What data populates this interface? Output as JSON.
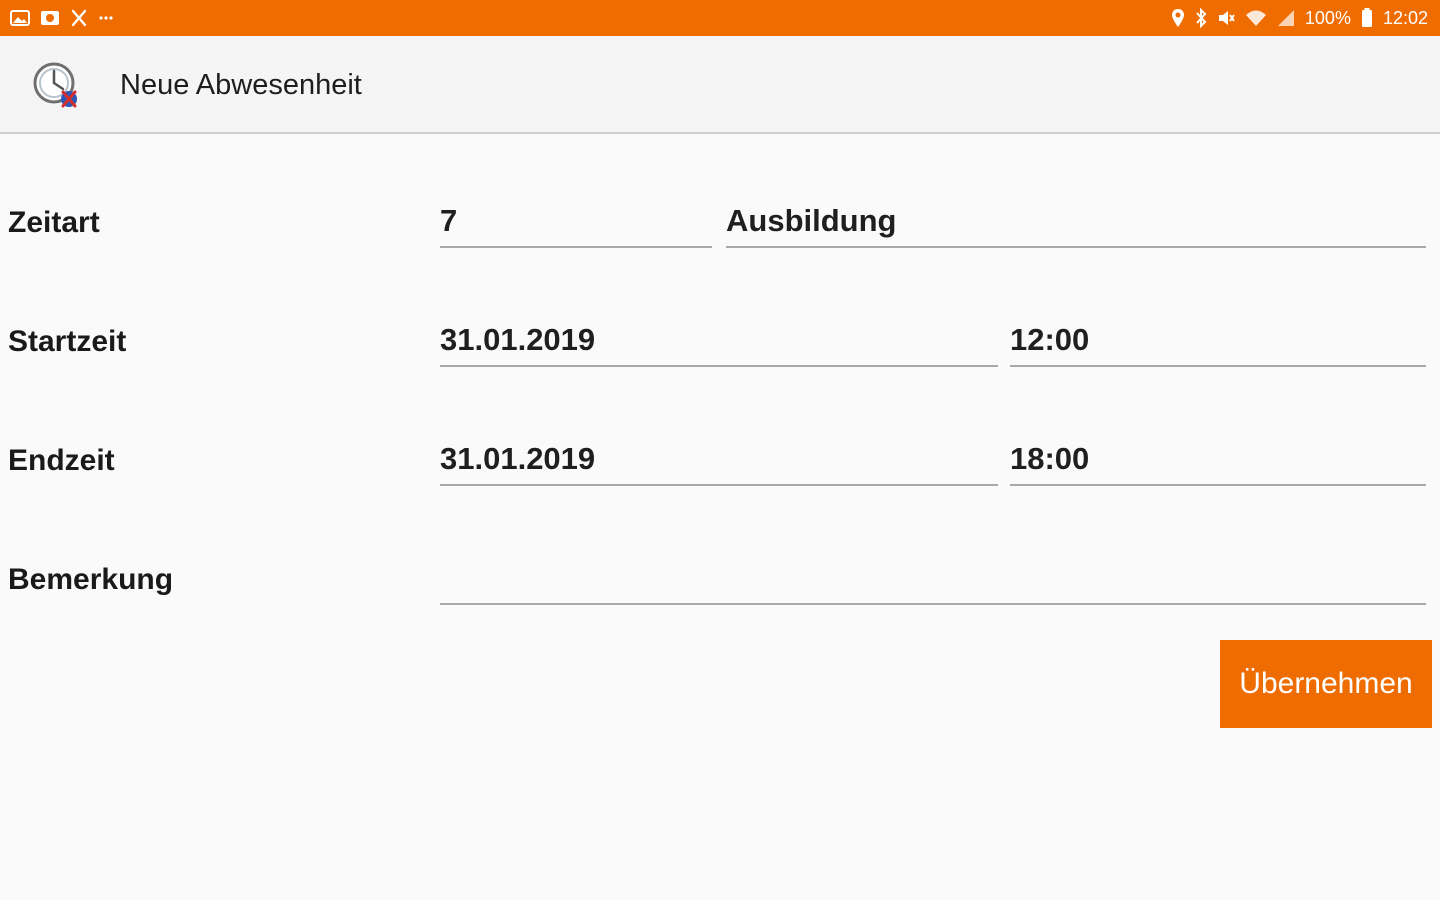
{
  "status_bar": {
    "left_icons": [
      "gallery-icon",
      "photo-icon",
      "tools-icon",
      "more-dots-icon"
    ],
    "right_icons": [
      "location-icon",
      "bluetooth-icon",
      "mute-icon",
      "wifi-icon",
      "signal-icon"
    ],
    "battery_percent": "100%",
    "battery_icon": "battery-icon",
    "time": "12:02",
    "color": "#ef6c00"
  },
  "app_bar": {
    "icon": "clock-absence-icon",
    "title": "Neue Abwesenheit"
  },
  "form": {
    "zeitart": {
      "label": "Zeitart",
      "code": "7",
      "name": "Ausbildung"
    },
    "startzeit": {
      "label": "Startzeit",
      "date": "31.01.2019",
      "time": "12:00"
    },
    "endzeit": {
      "label": "Endzeit",
      "date": "31.01.2019",
      "time": "18:00"
    },
    "bemerkung": {
      "label": "Bemerkung",
      "value": ""
    }
  },
  "actions": {
    "submit_label": "Übernehmen",
    "accent_color": "#ef6c00"
  }
}
